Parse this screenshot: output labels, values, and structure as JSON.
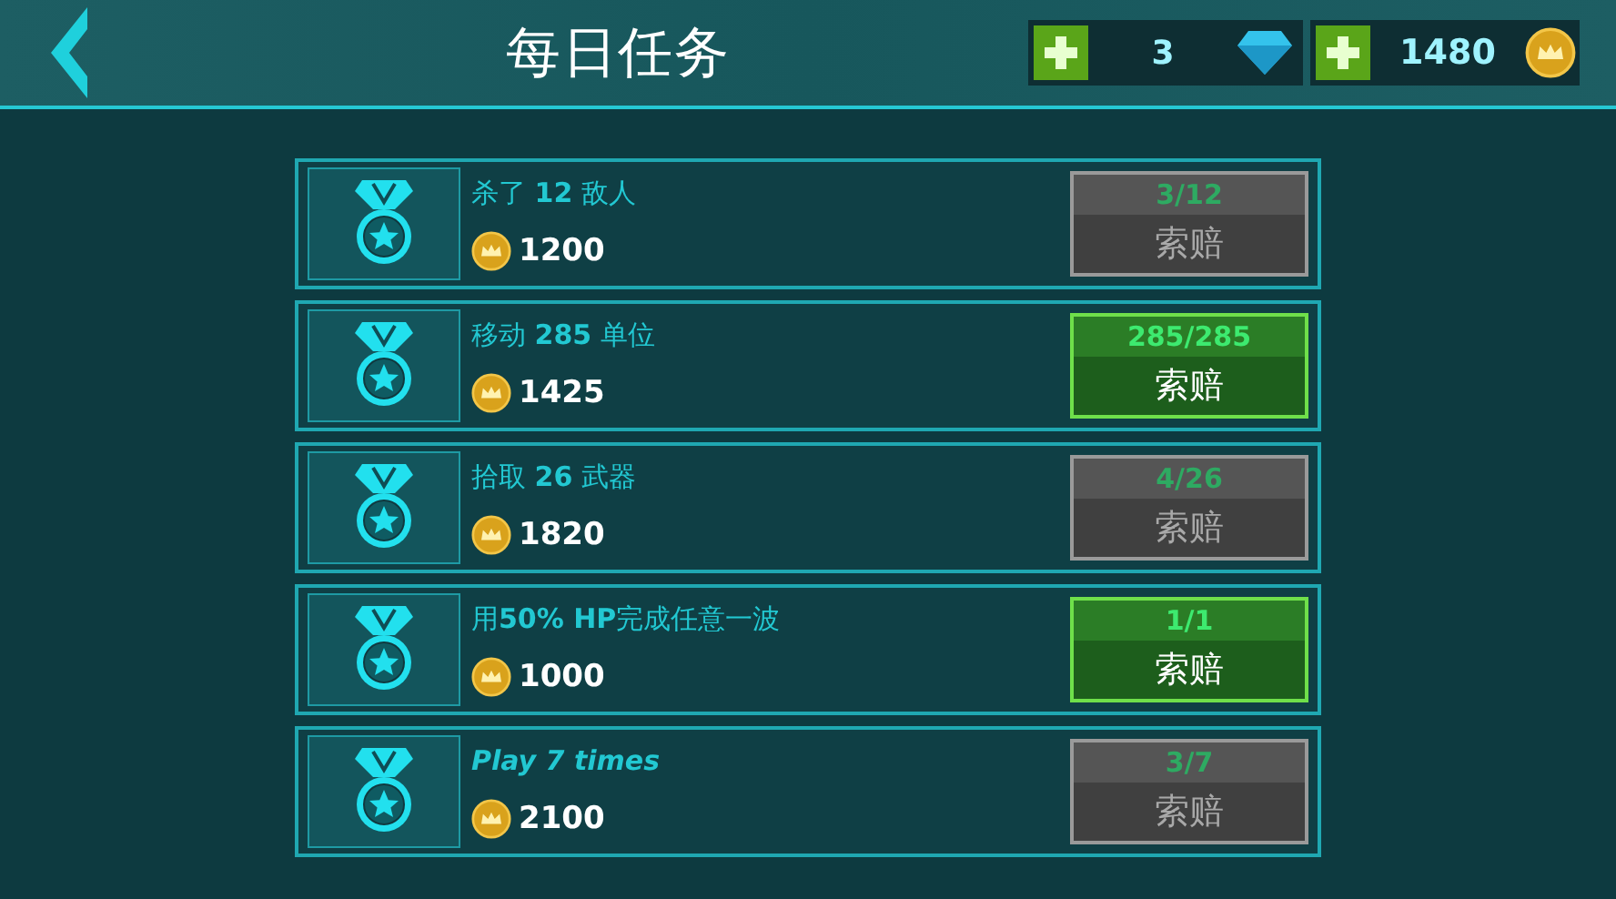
{
  "header": {
    "title": "每日任务",
    "gems": "3",
    "coins": "1480"
  },
  "tasks": [
    {
      "title": "杀了 **12** 敌人",
      "emphasis": false,
      "reward": "1200",
      "progress": "3/12",
      "claim": "索赔",
      "ready": false
    },
    {
      "title": "移动 **285** 单位",
      "emphasis": false,
      "reward": "1425",
      "progress": "285/285",
      "claim": "索赔",
      "ready": true
    },
    {
      "title": "拾取 **26** 武器",
      "emphasis": false,
      "reward": "1820",
      "progress": "4/26",
      "claim": "索赔",
      "ready": false
    },
    {
      "title": "用**50% HP**完成任意一波",
      "emphasis": false,
      "reward": "1000",
      "progress": "1/1",
      "claim": "索赔",
      "ready": true
    },
    {
      "title": "Play 7 times",
      "emphasis": true,
      "reward": "2100",
      "progress": "3/7",
      "claim": "索赔",
      "ready": false
    }
  ]
}
